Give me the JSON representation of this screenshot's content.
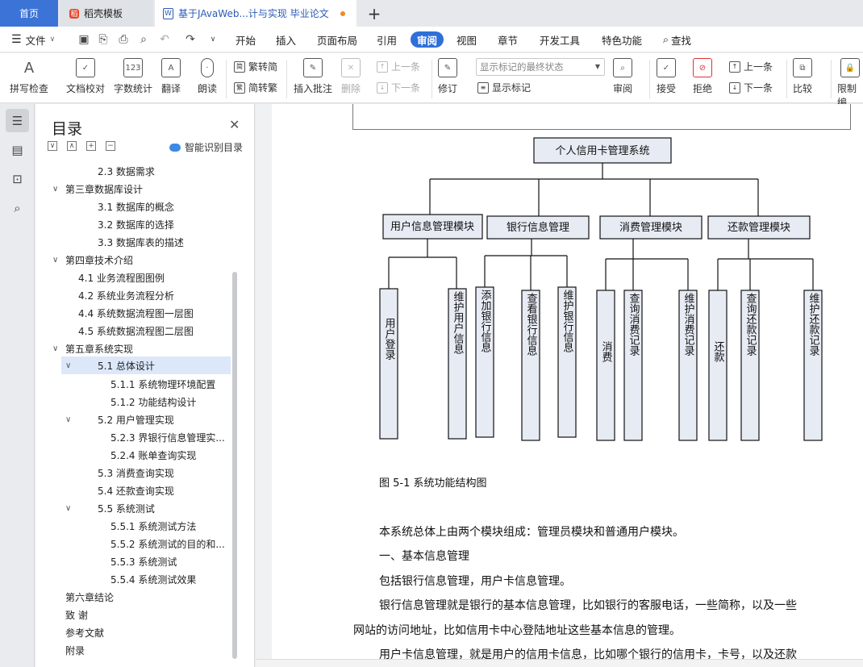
{
  "tabs": {
    "home": "首页",
    "template": "稻壳模板",
    "document": "基于JAvaWeb...计与实现 毕业论文"
  },
  "menu": {
    "file": "文件",
    "items": [
      "开始",
      "插入",
      "页面布局",
      "引用",
      "审阅",
      "视图",
      "章节",
      "开发工具",
      "特色功能"
    ],
    "search": "查找"
  },
  "ribbon": {
    "spell": "拼写检查",
    "proof": "文档校对",
    "wordcount": "字数统计",
    "translate": "翻译",
    "read": "朗读",
    "trad": "繁转简",
    "simp": "简转繁",
    "insert_comment": "插入批注",
    "delete": "删除",
    "prev_comment": "上一条",
    "next_comment": "下一条",
    "track": "修订",
    "mark_state": "显示标记的最终状态",
    "show_markup": "显示标记",
    "review": "审阅",
    "accept": "接受",
    "reject": "拒绝",
    "prev": "上一条",
    "next": "下一条",
    "compare": "比较",
    "restrict": "限制编"
  },
  "toc": {
    "title": "目录",
    "smart": "智能识别目录",
    "items": [
      "2.3  数据需求",
      "第三章数据库设计",
      "3.1  数据库的概念",
      "3.2  数据库的选择",
      "3.3  数据库表的描述",
      "第四章技术介绍",
      "4.1  业务流程图图例",
      "4.2 系统业务流程分析",
      "4.4 系统数据流程图一层图",
      "4.5  系统数据流程图二层图",
      "第五章系统实现",
      "5.1 总体设计",
      "5.1.1 系统物理环境配置",
      "5.1.2  功能结构设计",
      "5.2  用户管理实现",
      "5.2.3  界银行信息管理实...",
      "5.2.4  账单查询实现",
      "5.3  消费查询实现",
      "5.4  还款查询实现",
      "5.5  系统测试",
      "5.5.1  系统测试方法",
      "5.5.2  系统测试的目的和...",
      "5.5.3  系统测试",
      "5.5.4 系统测试效果",
      "第六章结论",
      "致   谢",
      "参考文献",
      "附录"
    ]
  },
  "diagram": {
    "root": "个人信用卡管理系统",
    "modules": [
      {
        "name": "用户信息管理模块",
        "children": [
          "用户登录",
          "维护用户信息"
        ]
      },
      {
        "name": "银行信息管理",
        "children": [
          "添加银行信息",
          "查看银行信息",
          "维护银行信息"
        ]
      },
      {
        "name": "消费管理模块",
        "children": [
          "消费",
          "查询消费记录",
          "维护消费记录"
        ]
      },
      {
        "name": "还款管理模块",
        "children": [
          "还款",
          "查询还款记录",
          "维护还款记录"
        ]
      }
    ]
  },
  "document": {
    "caption": "图 5-1 系统功能结构图",
    "p1": "本系统总体上由两个模块组成：管理员模块和普通用户模块。",
    "p2": "一、基本信息管理",
    "p3": "包括银行信息管理，用户卡信息管理。",
    "p4a": "银行信息管理就是银行的基本信息管理，比如银行的客服电话，一些简称，以及一些",
    "p4b": "网站的访问地址，比如信用卡中心登陆地址这些基本信息的管理。",
    "p5": "用户卡信息管理，就是用户的信用卡信息，比如哪个银行的信用卡，卡号，以及还款"
  }
}
